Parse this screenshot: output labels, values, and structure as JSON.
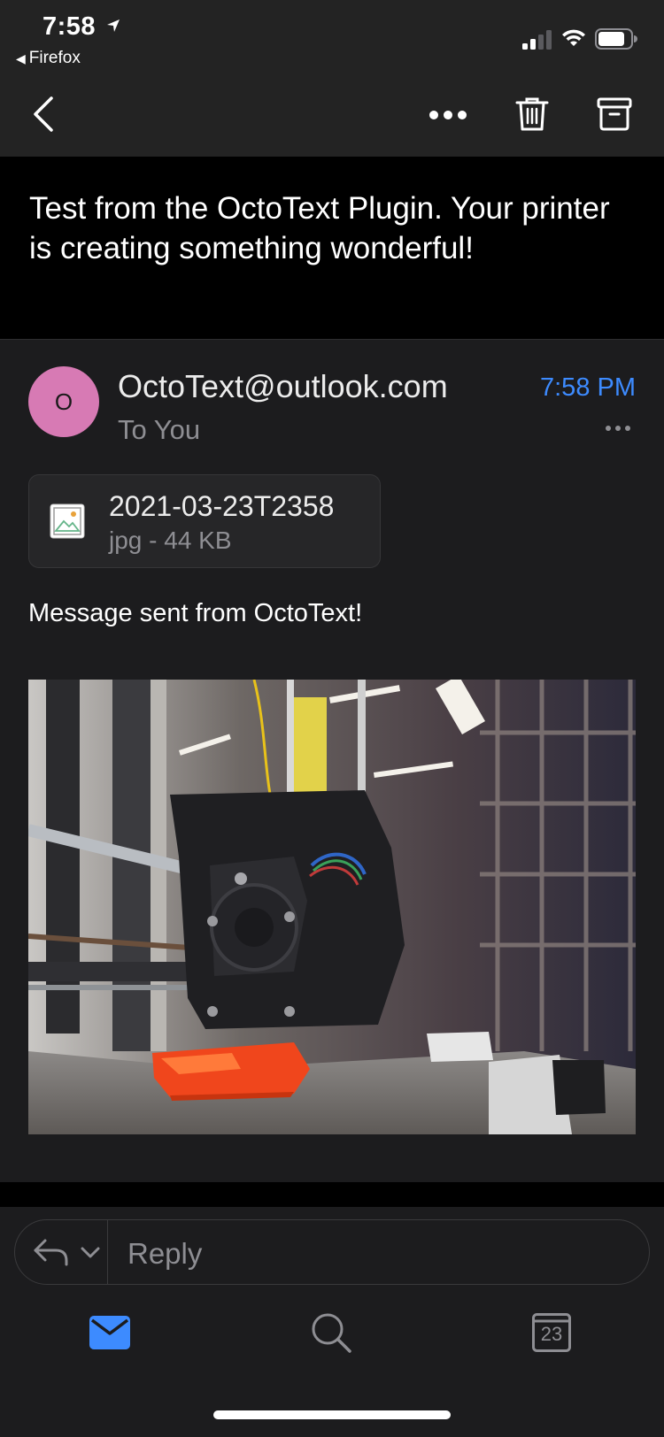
{
  "status_bar": {
    "time": "7:58",
    "back_app": "Firefox"
  },
  "message": {
    "subject": "Test from the OctoText Plugin. Your printer is creating something wonderful!",
    "sender_initial": "O",
    "sender": "OctoText@outlook.com",
    "time": "7:58 PM",
    "recipient_line": "To You",
    "attachment": {
      "name": "2021-03-23T2358",
      "meta": "jpg - 44 KB"
    },
    "body": "Message sent from OctoText!"
  },
  "reply": {
    "placeholder": "Reply"
  },
  "tabs": {
    "calendar_day": "23"
  },
  "colors": {
    "accent": "#3d8bff",
    "avatar": "#d77ab4",
    "background": "#1c1c1e",
    "subject_background": "#000000"
  }
}
